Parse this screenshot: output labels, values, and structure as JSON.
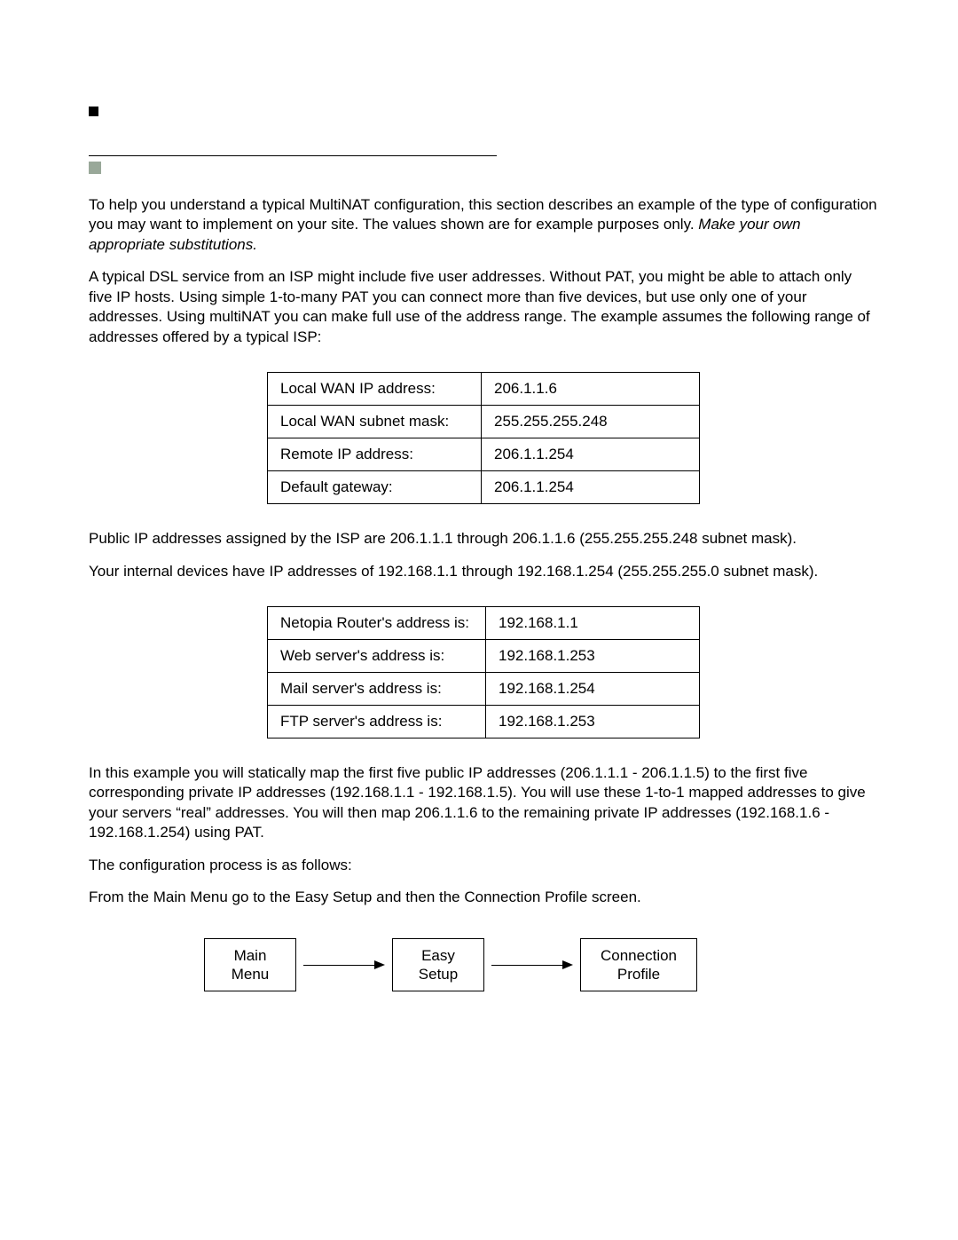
{
  "para1_a": "To help you understand a typical MultiNAT configuration, this section describes an example of the type of configuration you may want to implement on your site. The values shown are for example purposes only. ",
  "para1_b": "Make your own appropriate substitutions.",
  "para2": "A typical DSL service from an ISP might include five user addresses. Without PAT, you might be able to attach only five IP hosts. Using simple 1-to-many PAT you can connect more than five devices, but use only one of your addresses. Using multiNAT you can make full use of the address range. The example assumes the following range of addresses offered by a typical ISP:",
  "table1": [
    {
      "label": "Local WAN IP address:",
      "value": "206.1.1.6"
    },
    {
      "label": "Local WAN subnet mask:",
      "value": "255.255.255.248"
    },
    {
      "label": "Remote IP address:",
      "value": "206.1.1.254"
    },
    {
      "label": "Default gateway:",
      "value": "206.1.1.254"
    }
  ],
  "para3": "Public IP addresses assigned by the ISP are 206.1.1.1 through 206.1.1.6 (255.255.255.248 subnet mask).",
  "para4": "Your internal devices have IP addresses of 192.168.1.1 through 192.168.1.254 (255.255.255.0 subnet mask).",
  "table2": [
    {
      "label": "Netopia Router's address is:",
      "value": "192.168.1.1"
    },
    {
      "label": "Web server's address is:",
      "value": "192.168.1.253"
    },
    {
      "label": "Mail server's address is:",
      "value": "192.168.1.254"
    },
    {
      "label": "FTP server's address is:",
      "value": "192.168.1.253"
    }
  ],
  "para5": "In this example you will statically map the first five public IP addresses (206.1.1.1 - 206.1.1.5) to the first five corresponding private IP addresses (192.168.1.1 - 192.168.1.5). You will use these 1-to-1 mapped addresses to give your servers “real” addresses. You will then map 206.1.1.6 to the remaining private IP addresses (192.168.1.6 - 192.168.1.254) using PAT.",
  "para6": "The configuration process is as follows:",
  "para7": "From the Main Menu go to the Easy Setup and then the Connection Profile screen.",
  "nav": {
    "box1_l1": "Main",
    "box1_l2": "Menu",
    "box2_l1": "Easy",
    "box2_l2": "Setup",
    "box3_l1": "Connection",
    "box3_l2": "Profile"
  }
}
